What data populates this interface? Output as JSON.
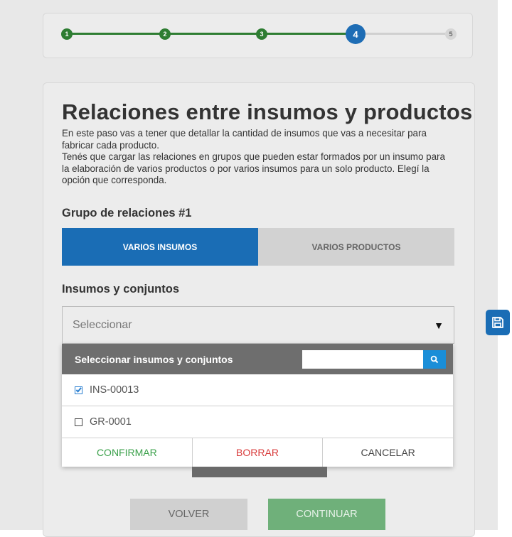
{
  "stepper": {
    "steps": [
      "1",
      "2",
      "3",
      "4",
      "5"
    ],
    "current": 4,
    "colors": {
      "done": "#2e7d32",
      "current": "#1e6db5",
      "future": "#d6d6d6"
    }
  },
  "main": {
    "title": "Relaciones entre insumos y productos",
    "description": [
      "En este paso vas a tener que detallar la cantidad de insumos que vas a necesitar para fabricar cada producto.",
      "Tenés que cargar las relaciones en grupos que pueden estar formados por un insumo para la elaboración de varios productos o por varios insumos para un solo producto. Elegí la opción que corresponda."
    ],
    "group_title": "Grupo de relaciones #1",
    "toggle": {
      "active_label": "VARIOS INSUMOS",
      "inactive_label": "VARIOS PRODUCTOS"
    },
    "field_label": "Insumos y conjuntos",
    "select": {
      "value": "Seleccionar",
      "arrow_icon": "caret-down-icon"
    }
  },
  "dropdown": {
    "header_label": "Seleccionar insumos y conjuntos",
    "search": {
      "value": "",
      "placeholder": "",
      "icon": "search-icon"
    },
    "items": [
      {
        "label": "INS-00013",
        "checked": true
      },
      {
        "label": "GR-0001",
        "checked": false
      }
    ],
    "actions": {
      "confirm": "CONFIRMAR",
      "delete": "BORRAR",
      "cancel": "CANCELAR"
    }
  },
  "footer": {
    "back": "VOLVER",
    "next": "CONTINUAR"
  },
  "side": {
    "save_icon": "save-icon"
  }
}
